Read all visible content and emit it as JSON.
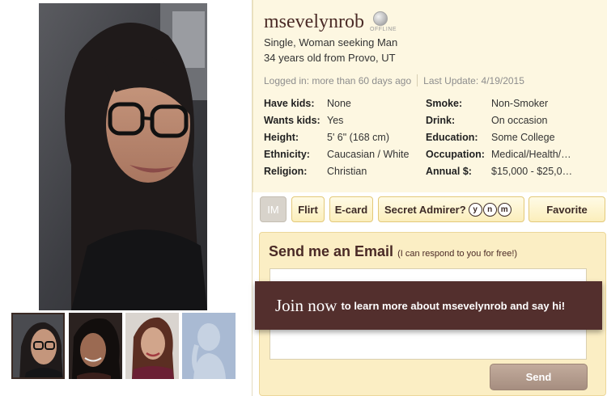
{
  "profile": {
    "username": "msevelynrob",
    "status": "OFFLINE",
    "seeking": "Single, Woman seeking Man",
    "age_location": "34 years old from Provo, UT",
    "logged_in": "Logged in: more than 60 days ago",
    "last_update": "Last Update: 4/19/2015"
  },
  "details_left": [
    {
      "label": "Have kids:",
      "value": "None"
    },
    {
      "label": "Wants kids:",
      "value": "Yes"
    },
    {
      "label": "Height:",
      "value": "5' 6\" (168 cm)"
    },
    {
      "label": "Ethnicity:",
      "value": "Caucasian / White"
    },
    {
      "label": "Religion:",
      "value": "Christian"
    }
  ],
  "details_right": [
    {
      "label": "Smoke:",
      "value": "Non-Smoker"
    },
    {
      "label": "Drink:",
      "value": "On occasion"
    },
    {
      "label": "Education:",
      "value": "Some College"
    },
    {
      "label": "Occupation:",
      "value": "Medical/Health/…"
    },
    {
      "label": "Annual $:",
      "value": "$15,000 - $25,0…"
    }
  ],
  "actions": {
    "im": "IM",
    "flirt": "Flirt",
    "ecard": "E-card",
    "secret_admirer": "Secret Admirer?",
    "ynm": [
      "y",
      "n",
      "m"
    ],
    "favorite": "Favorite"
  },
  "email": {
    "title": "Send me an Email",
    "subtitle": "(I can respond to you for free!)",
    "send": "Send"
  },
  "join": {
    "big": "Join now",
    "small": "to learn more about msevelynrob and say hi!"
  },
  "colors": {
    "accent": "#532f2d",
    "panel": "#fbeec4",
    "header_bg": "#fdf7e1"
  }
}
